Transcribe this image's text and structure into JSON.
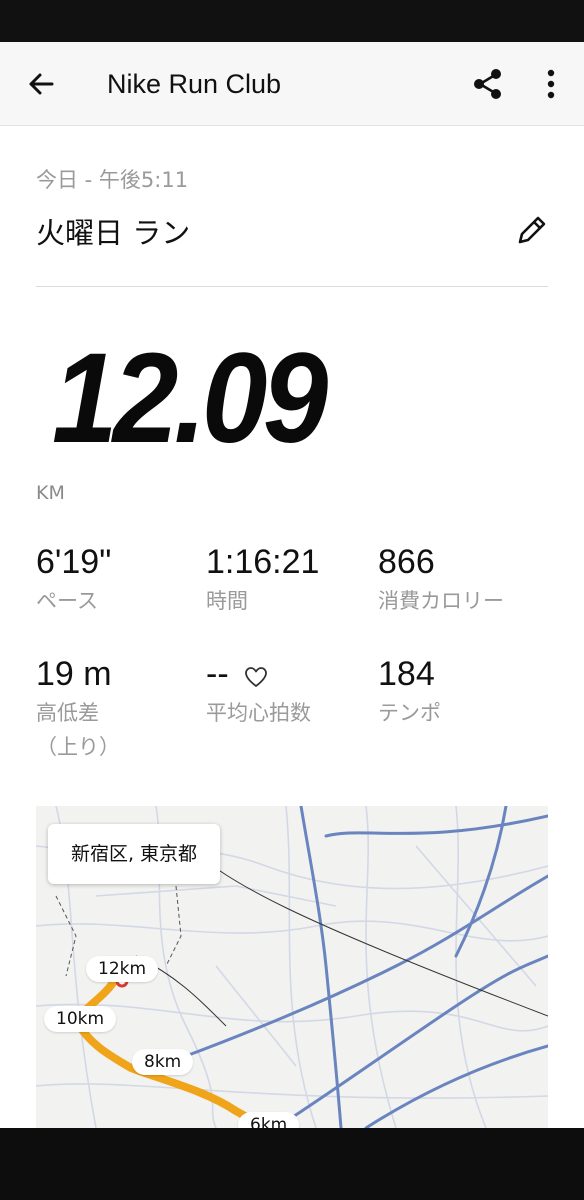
{
  "app_bar": {
    "title": "Nike Run Club",
    "icons": {
      "back": "arrow-left-icon",
      "share": "share-icon",
      "more": "more-vert-icon"
    }
  },
  "activity": {
    "date": "今日 - 午後5:11",
    "title": "火曜日 ラン",
    "edit_icon": "pencil-icon",
    "distance": "12.09",
    "unit": "KM"
  },
  "stats": [
    {
      "value": "6'19\"",
      "label": "ペース"
    },
    {
      "value": "1:16:21",
      "label": "時間"
    },
    {
      "value": "866",
      "label": "消費カロリー"
    },
    {
      "value": "19 m",
      "label": "高低差\n（上り）"
    },
    {
      "value": "--",
      "label": "平均心拍数",
      "icon": "heart-icon"
    },
    {
      "value": "184",
      "label": "テンポ"
    }
  ],
  "map": {
    "location": "新宿区, 東京都",
    "markers": [
      "12km",
      "10km",
      "8km",
      "6km"
    ]
  },
  "colors": {
    "route": "#f0a41a",
    "major_road": "#5c7ab8",
    "minor_road": "#c8cfe0",
    "label_gray": "#9a9a9a"
  }
}
